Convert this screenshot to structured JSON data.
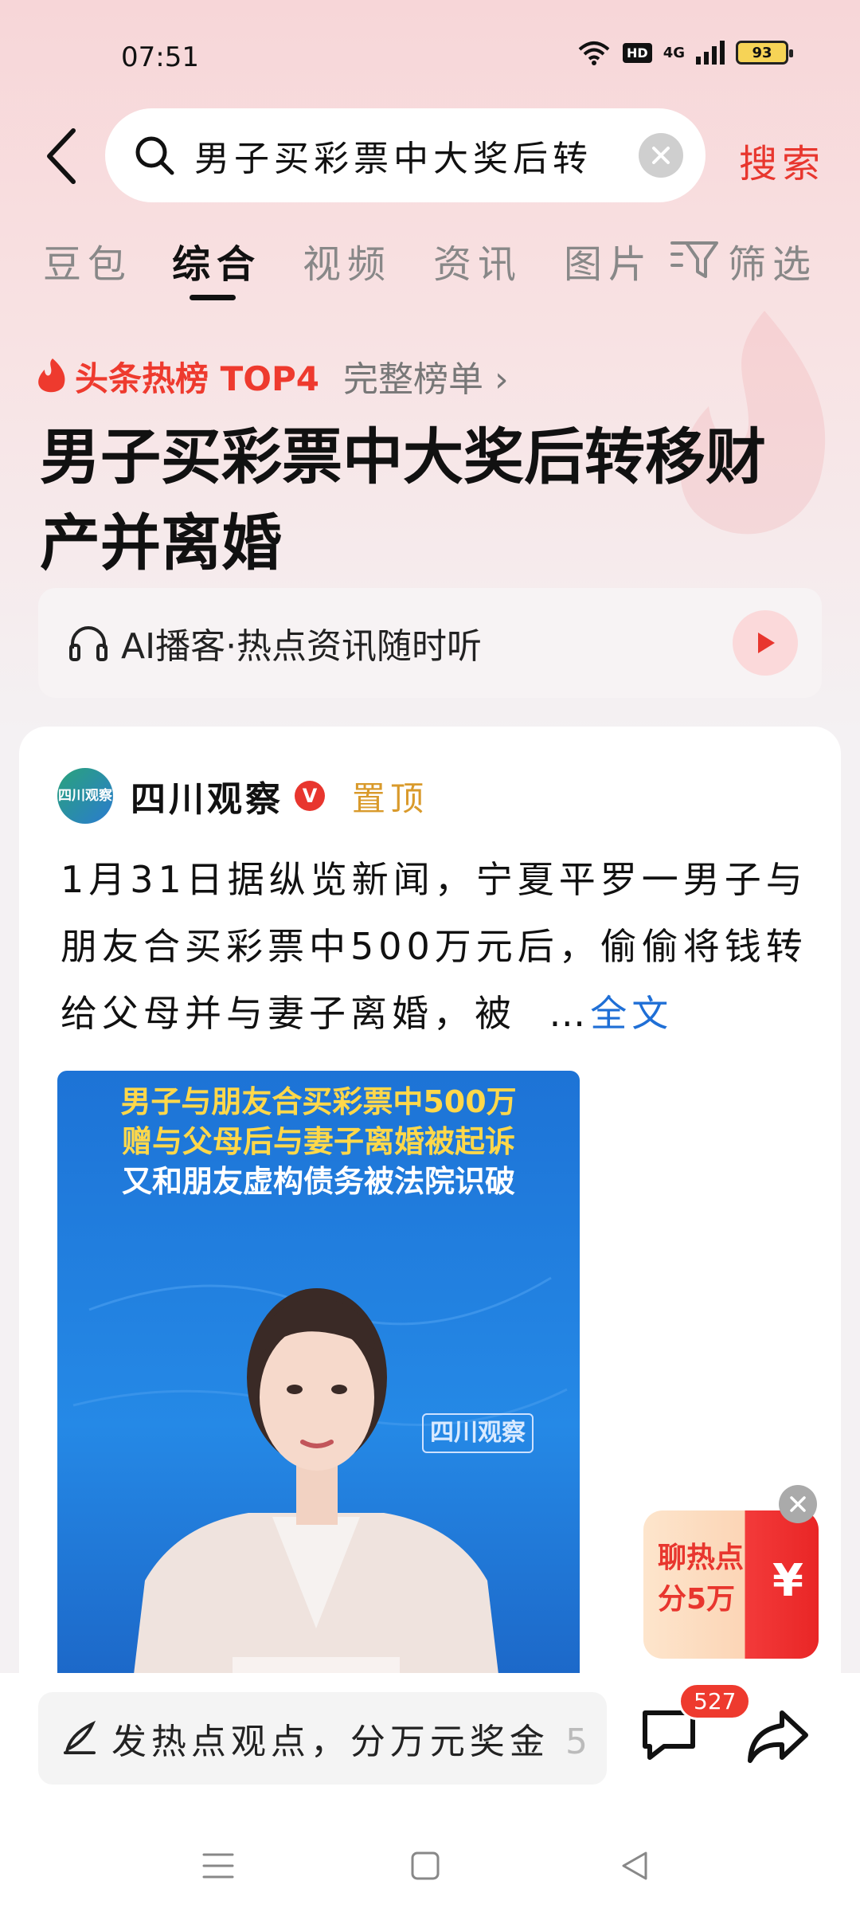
{
  "status_bar": {
    "time": "07:51",
    "hd": "HD",
    "network": "4G",
    "battery": "93"
  },
  "search": {
    "query": "男子买彩票中大奖后转",
    "button": "搜索"
  },
  "tabs": [
    {
      "label": "豆包"
    },
    {
      "label": "综合"
    },
    {
      "label": "视频"
    },
    {
      "label": "资讯"
    },
    {
      "label": "图片"
    }
  ],
  "filter_label": "筛选",
  "hot_list": {
    "label": "头条热榜 TOP4",
    "link": "完整榜单 ›"
  },
  "headline": "男子买彩票中大奖后转移财产并离婚",
  "ai_podcast": "AI播客·热点资讯随时听",
  "post": {
    "avatar_text": "四川观察",
    "author": "四川观察",
    "verified": "V",
    "pinned": "置顶",
    "body": "1月31日据纵览新闻，宁夏平罗一男子与朋友合买彩票中500万元后，偷偷将钱转给父母并与妻子离婚，被",
    "ellipsis": "…",
    "full_text": "全文",
    "video_caption": [
      "男子与朋友合买彩票中500万",
      "赠与父母后与妻子离婚被起诉",
      "又和朋友虚构债务被法院识破"
    ],
    "video_logo": "四川观察"
  },
  "promo": {
    "line1": "聊热点",
    "line2": "分5万",
    "symbol": "¥"
  },
  "bottom_bar": {
    "comment_placeholder": "发热点观点，分万元奖金",
    "comment_tail": "5.",
    "comment_count": "527"
  },
  "colors": {
    "accent_red": "#e8362e",
    "link_blue": "#1f6fd6",
    "pinned_gold": "#d99a2b"
  }
}
